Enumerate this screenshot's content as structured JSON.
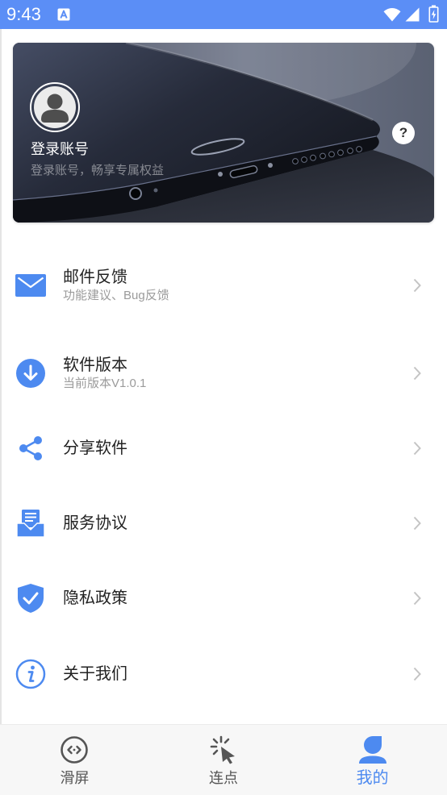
{
  "theme": {
    "accent": "#4d8af0",
    "status_bar": "#5b8ef6",
    "text_primary": "#222222",
    "text_secondary": "#9b9b9b",
    "chevron": "#c4c4c4",
    "nav_inactive": "#555555",
    "nav_bg": "#f7f7f7"
  },
  "status_bar": {
    "time": "9:43",
    "icons": [
      "keyboard-a-icon",
      "wifi-icon",
      "signal-icon",
      "battery-charging-icon"
    ]
  },
  "profile": {
    "title": "登录账号",
    "subtitle": "登录账号，畅享专属权益",
    "avatar_icon": "avatar-icon",
    "help_icon": "help-icon",
    "help_glyph": "?"
  },
  "menu": {
    "items": [
      {
        "label": "邮件反馈",
        "subtitle": "功能建议、Bug反馈",
        "icon": "mail-icon"
      },
      {
        "label": "软件版本",
        "subtitle": "当前版本V1.0.1",
        "icon": "download-icon"
      },
      {
        "label": "分享软件",
        "icon": "share-icon"
      },
      {
        "label": "服务协议",
        "icon": "document-tray-icon"
      },
      {
        "label": "隐私政策",
        "icon": "shield-check-icon"
      },
      {
        "label": "关于我们",
        "icon": "info-icon"
      }
    ]
  },
  "bottom_nav": {
    "tabs": [
      {
        "label": "滑屏",
        "icon": "code-circle-icon",
        "active": false
      },
      {
        "label": "连点",
        "icon": "click-pointer-icon",
        "active": false
      },
      {
        "label": "我的",
        "icon": "person-icon",
        "active": true
      }
    ]
  }
}
